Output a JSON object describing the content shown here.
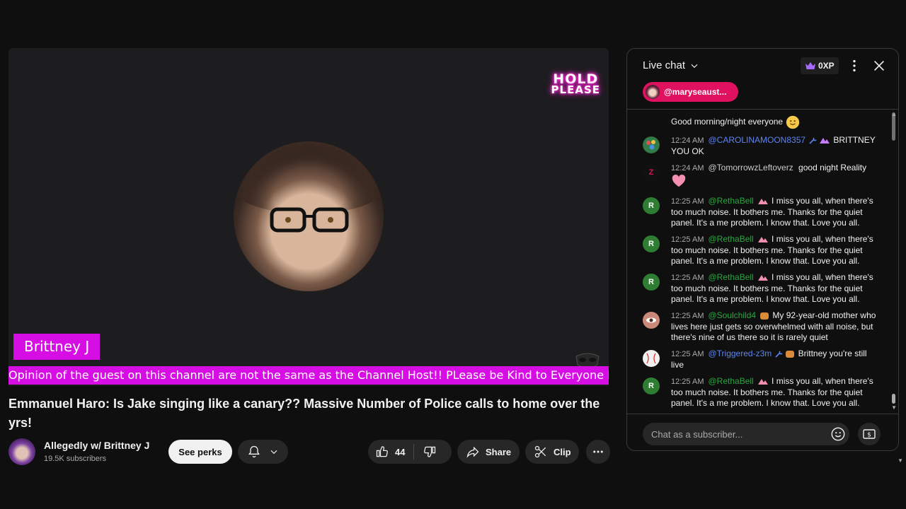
{
  "video": {
    "overlay_badge_line1": "HOLD",
    "overlay_badge_line2": "PLEASE",
    "name_tag": "Brittney J",
    "ticker": "Opinion of the guest on this channel are not the same as the Channel Host!! PLease be Kind to Everyone Ev"
  },
  "title": "Emmanuel Haro: Is Jake singing like a canary?? Massive Number of Police calls to home over the yrs!",
  "channel": {
    "name": "Allegedly w/ Brittney J",
    "subscribers": "19.5K subscribers"
  },
  "actions": {
    "see_perks": "See perks",
    "like_count": "44",
    "share": "Share",
    "clip": "Clip"
  },
  "chat": {
    "title": "Live chat",
    "xp": "0XP",
    "pinned_user": "@maryseaust...",
    "input_placeholder": "Chat as a subscriber...",
    "messages": [
      {
        "time": "",
        "author": "",
        "text": "Good morning/night everyone"
      },
      {
        "time": "12:24 AM",
        "author": "@CAROLINAMOON8357",
        "text": "BRITTNEY YOU OK"
      },
      {
        "time": "12:24 AM",
        "author": "@TomorrowzLeftoverz",
        "text": "good night Reality"
      },
      {
        "time": "12:25 AM",
        "author": "@RethaBell",
        "text": "I miss you all, when there's too much noise. It bothers me. Thanks for the quiet panel. It's a me problem. I know that. Love you all."
      },
      {
        "time": "12:25 AM",
        "author": "@RethaBell",
        "text": "I miss you all, when there's too much noise. It bothers me. Thanks for the quiet panel. It's a me problem. I know that. Love you all."
      },
      {
        "time": "12:25 AM",
        "author": "@RethaBell",
        "text": "I miss you all, when there's too much noise. It bothers me. Thanks for the quiet panel. It's a me problem. I know that. Love you all."
      },
      {
        "time": "12:25 AM",
        "author": "@Soulchild4",
        "text": "My 92-year-old mother who lives here just gets so overwhelmed with all noise, but there's nine of us there so it is rarely quiet"
      },
      {
        "time": "12:25 AM",
        "author": "@Triggered-z3m",
        "text": "Brittney you're still live"
      },
      {
        "time": "12:25 AM",
        "author": "@RethaBell",
        "text": "I miss you all, when there's too much noise. It bothers me. Thanks for the quiet panel. It's a me problem. I know that. Love you all."
      }
    ],
    "avatar_letter_r": "R",
    "avatar_letter_z": "Z"
  },
  "colors": {
    "accent_magenta": "#d60ee4",
    "pinned_pink": "#e0115f",
    "author_blue": "#5e84f1",
    "author_green": "#2ba640"
  }
}
